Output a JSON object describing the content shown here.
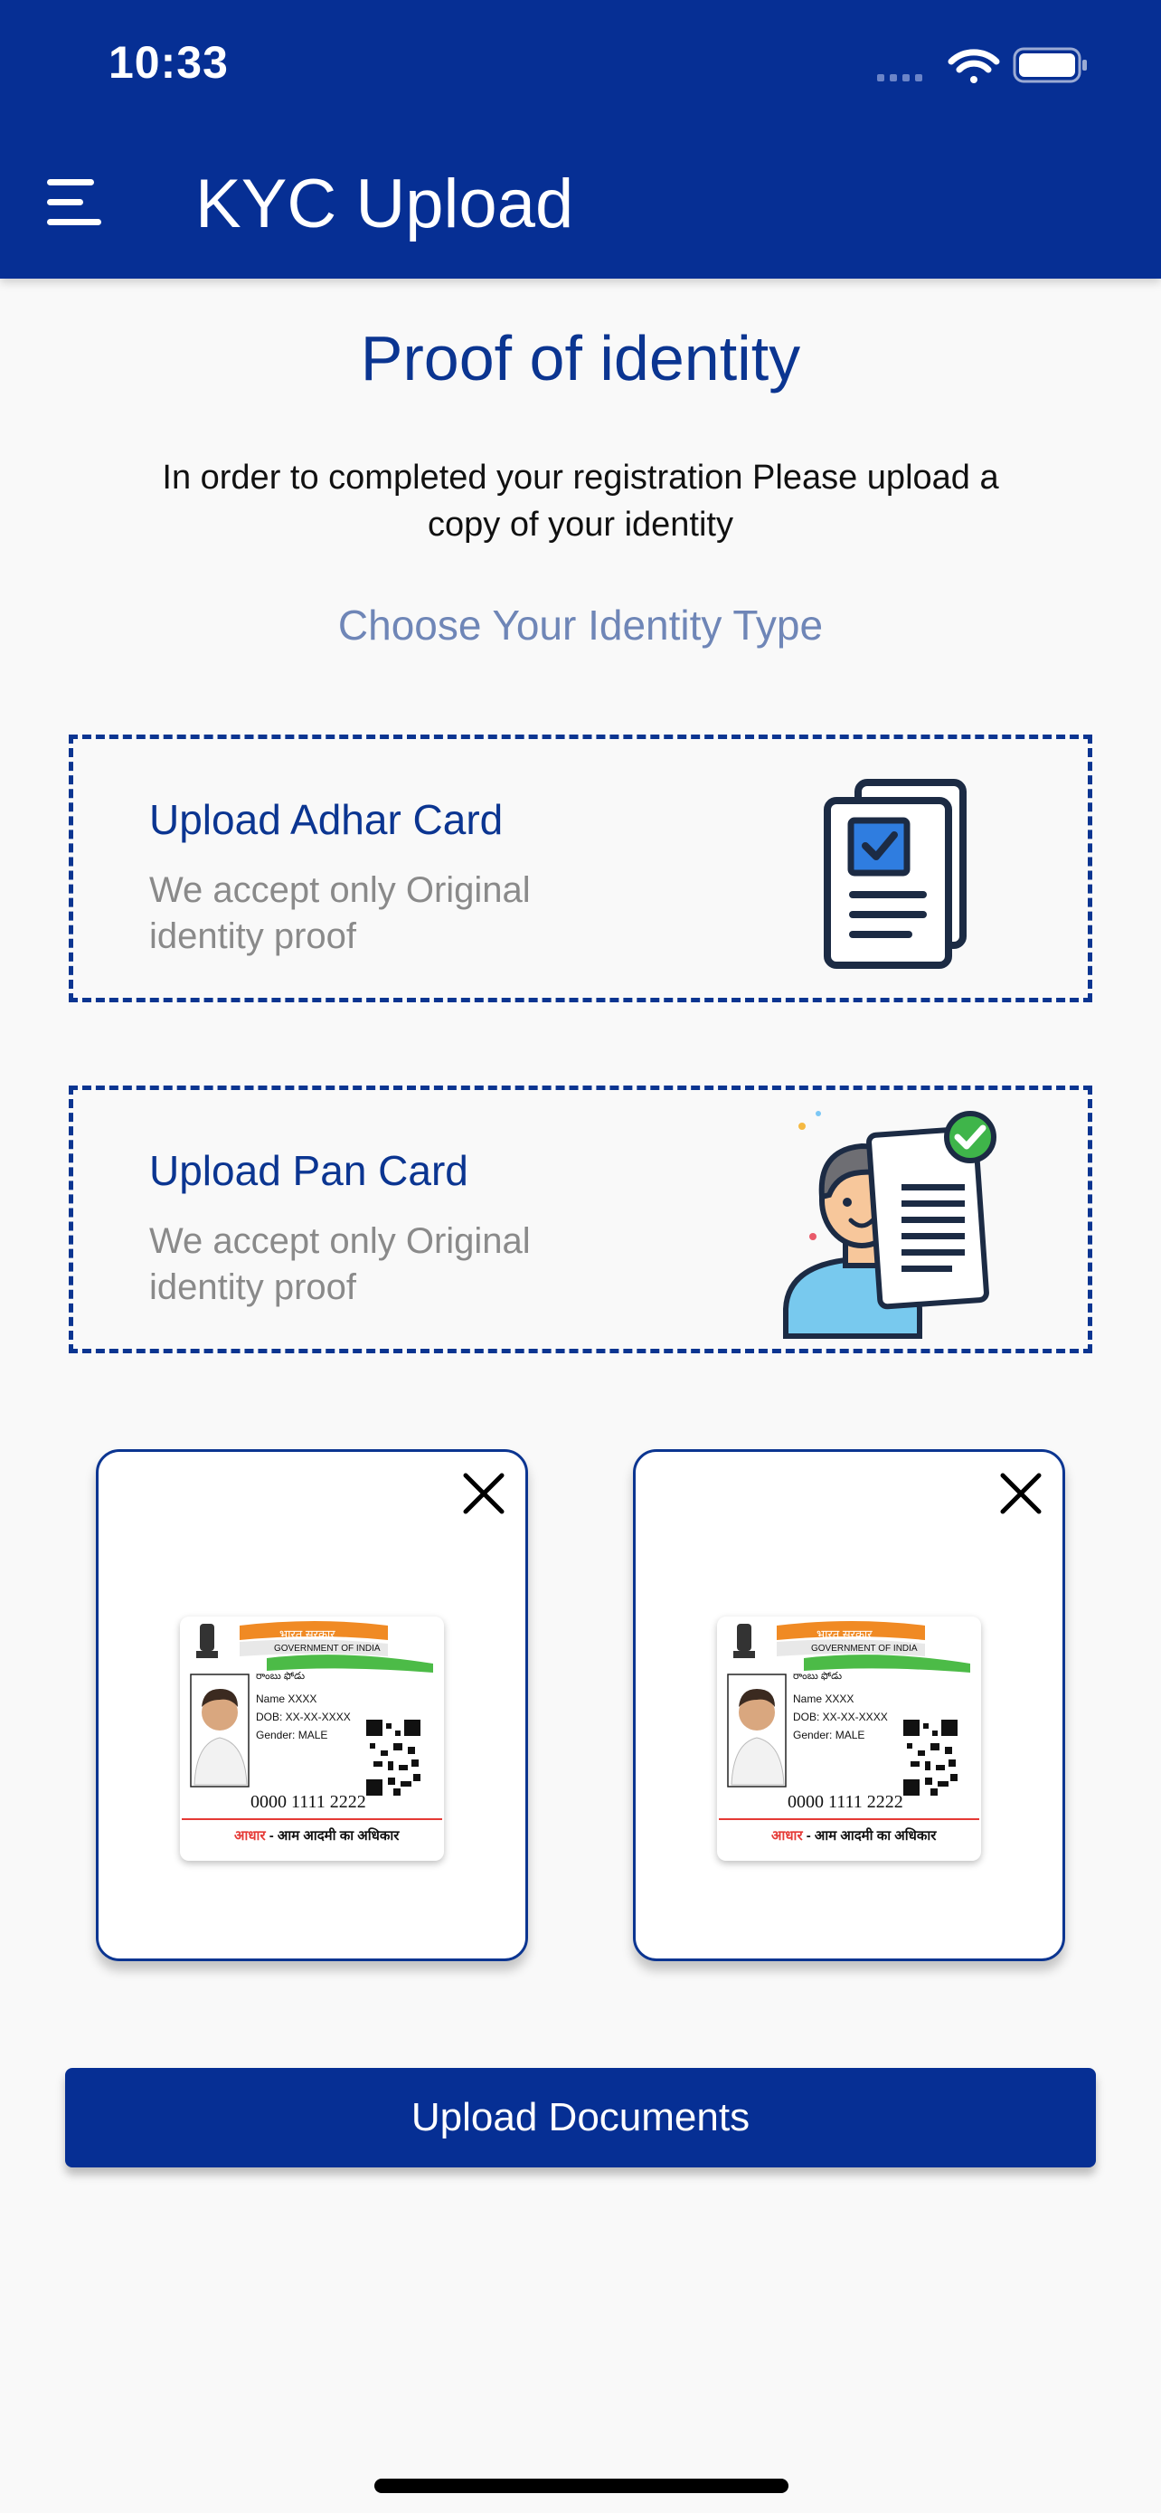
{
  "status_bar": {
    "time": "10:33"
  },
  "header": {
    "title": "KYC Upload",
    "menu_icon": "hamburger-menu-icon"
  },
  "main": {
    "title": "Proof of identity",
    "intro": "In order to completed your registration Please upload a copy of your identity",
    "choose_label": "Choose Your Identity Type",
    "options": [
      {
        "title": "Upload Adhar Card",
        "subtitle": "We accept only Original identity proof",
        "icon": "document-check-icon"
      },
      {
        "title": "Upload Pan Card",
        "subtitle": "We accept only Original identity proof",
        "icon": "person-with-document-icon"
      }
    ],
    "previews": [
      {
        "gov_hindi": "भारत सरकार",
        "gov_english": "GOVERNMENT OF INDIA",
        "regional_name": "రాంబు ఫోడు",
        "name": "Name XXXX",
        "dob": "DOB: XX-XX-XXXX",
        "gender": "Gender: MALE",
        "number": "0000 1111 2222",
        "footer_red": "आधार",
        "footer_black": " - आम आदमी का अधिकार"
      },
      {
        "gov_hindi": "भारत सरकार",
        "gov_english": "GOVERNMENT OF INDIA",
        "regional_name": "రాంబు ఫోడు",
        "name": "Name XXXX",
        "dob": "DOB: XX-XX-XXXX",
        "gender": "Gender: MALE",
        "number": "0000 1111 2222",
        "footer_red": "आधार",
        "footer_black": " - आम आदमी का अधिकार"
      }
    ],
    "upload_button": "Upload Documents"
  },
  "colors": {
    "primary": "#062f94",
    "accent_text": "#0b3591",
    "muted": "#8a8a8a",
    "choose": "#6f86b7"
  }
}
